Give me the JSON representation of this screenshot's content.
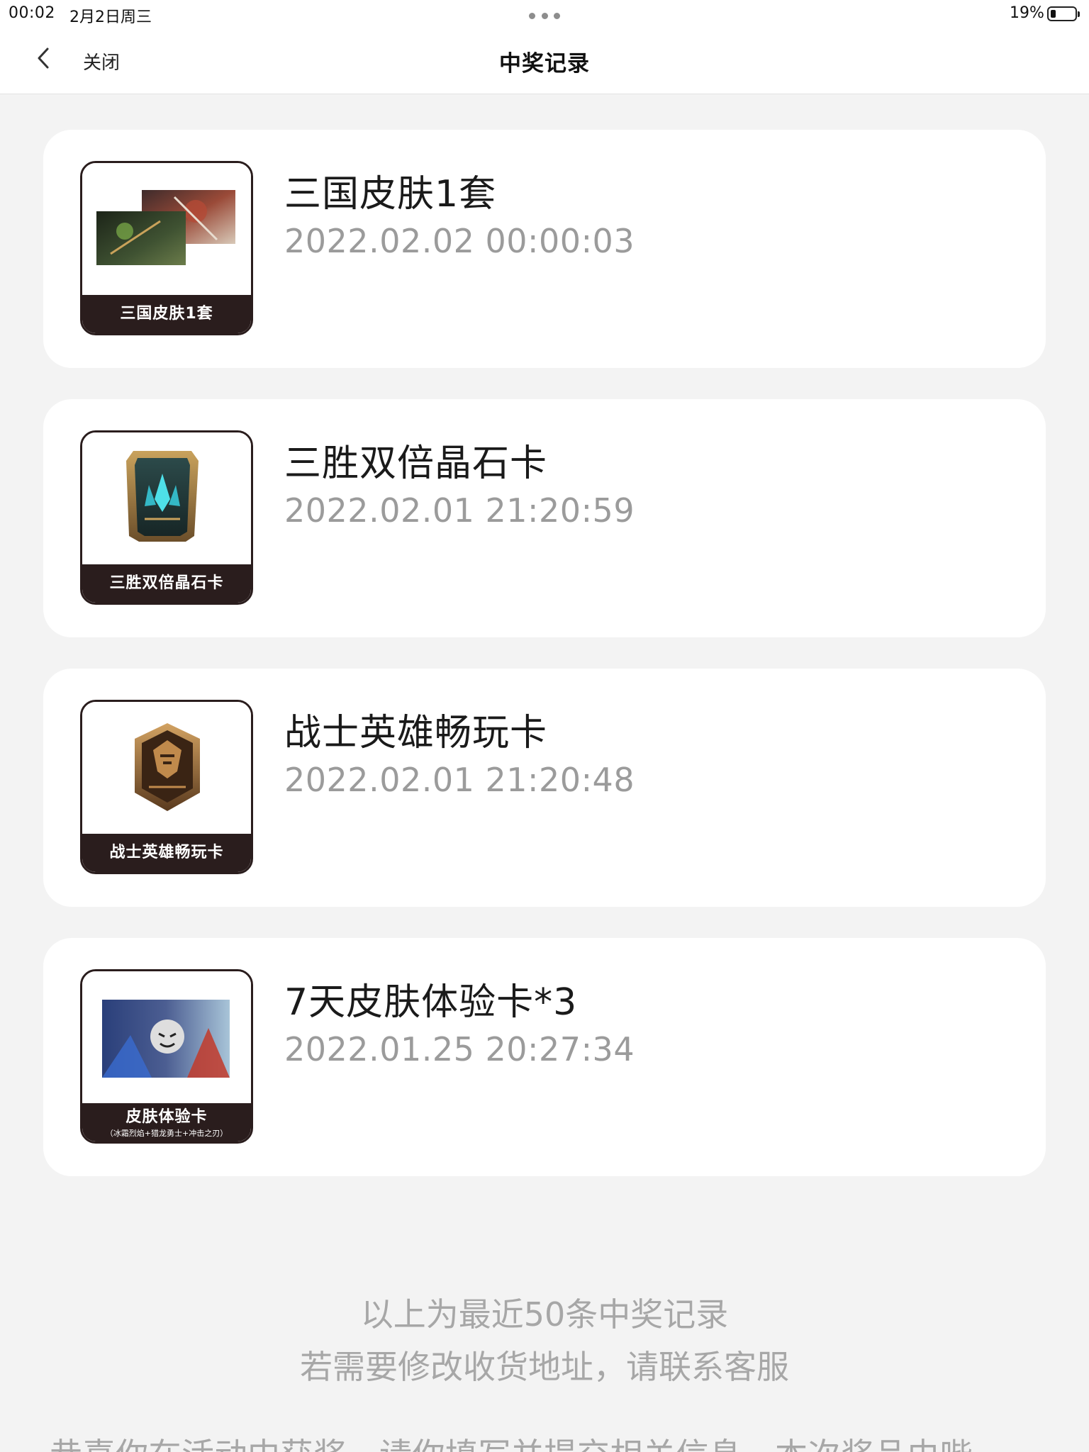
{
  "status_bar": {
    "time": "00:02",
    "date": "2月2日周三",
    "battery": "19%"
  },
  "nav": {
    "close_label": "关闭",
    "title": "中奖记录"
  },
  "records": [
    {
      "name": "三国皮肤1套",
      "time": "2022.02.02 00:00:03",
      "thumb_label": "三国皮肤1套"
    },
    {
      "name": "三胜双倍晶石卡",
      "time": "2022.02.01 21:20:59",
      "thumb_label": "三胜双倍晶石卡"
    },
    {
      "name": "战士英雄畅玩卡",
      "time": "2022.02.01 21:20:48",
      "thumb_label": "战士英雄畅玩卡"
    },
    {
      "name": "7天皮肤体验卡*3",
      "time": "2022.01.25 20:27:34",
      "thumb_label": "皮肤体验卡",
      "thumb_sublabel": "（冰霜烈焰+猎龙勇士+冲击之刃）"
    }
  ],
  "footer": {
    "line1": "以上为最近50条中奖记录",
    "line2": "若需要修改收货地址，请联系客服",
    "line3": "恭喜你在活动中获奖，请你填写并提交相关信息，本次奖品由哔"
  },
  "colors": {
    "background": "#f3f3f3",
    "card": "#ffffff",
    "time_text": "#9b9b9b",
    "thumb_band": "#2a1d1d"
  }
}
